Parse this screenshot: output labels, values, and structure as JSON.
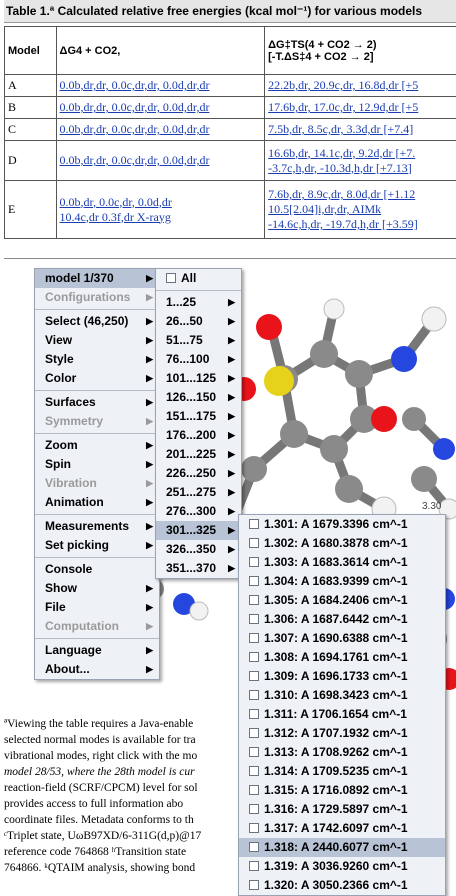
{
  "table": {
    "title": "Table 1.ª Calculated relative free energies (kcal mol⁻¹) for various models",
    "headers": {
      "model": "Model",
      "dg4": "ΔG4 + CO2,",
      "dgts": "ΔG‡TS(4 + CO2 → 2)",
      "tds": "[-T.ΔS‡4 + CO2 → 2]"
    },
    "rows": [
      {
        "model": "A",
        "col1": "0.0b,dr,dr, 0.0c,dr,dr, 0.0d,dr,dr",
        "col2": "22.2b,dr, 20.9c,dr, 16.8d,dr [+5"
      },
      {
        "model": "B",
        "col1": "0.0b,dr,dr, 0.0c,dr,dr, 0.0d,dr,dr",
        "col2": "17.6b,dr, 17.0c,dr, 12.9d,dr [+5"
      },
      {
        "model": "C",
        "col1": "0.0b,dr,dr, 0.0c,dr,dr, 0.0d,dr,dr",
        "col2": "7.5b,dr, 8.5c,dr, 3.3d,dr [+7.4]"
      },
      {
        "model": "D",
        "col1": "0.0b,dr,dr, 0.0c,dr,dr, 0.0d,dr,dr",
        "col2a": "16.6b,dr, 14.1c,dr, 9.2d,dr [+7.",
        "col2b": "-3.7c,h,dr, -10.3d,h,dr [+7.13]"
      },
      {
        "model": "E",
        "col1a": "0.0b,dr, 0.0c,dr, 0.0d,dr",
        "col1b": "10.4c,dr 0.3f,dr X-rayg",
        "col2a": "7.6b,dr, 8.9c,dr, 8.0d,dr [+1.12",
        "col2b": "10.5[2.04]i,dr,dr, AIMk",
        "col2c": "-14.6c,h,dr, -19.7d,h,dr [+3.59]"
      }
    ]
  },
  "menu_main": {
    "items": [
      {
        "label": "model 1/370",
        "arrow": true,
        "selected": true
      },
      {
        "label": "Configurations",
        "arrow": true,
        "disabled": true
      },
      {
        "sep": true
      },
      {
        "label": "Select (46,250)",
        "arrow": true
      },
      {
        "label": "View",
        "arrow": true
      },
      {
        "label": "Style",
        "arrow": true
      },
      {
        "label": "Color",
        "arrow": true
      },
      {
        "sep": true
      },
      {
        "label": "Surfaces",
        "arrow": true
      },
      {
        "label": "Symmetry",
        "arrow": true,
        "disabled": true
      },
      {
        "sep": true
      },
      {
        "label": "Zoom",
        "arrow": true
      },
      {
        "label": "Spin",
        "arrow": true
      },
      {
        "label": "Vibration",
        "arrow": true,
        "disabled": true
      },
      {
        "label": "Animation",
        "arrow": true
      },
      {
        "sep": true
      },
      {
        "label": "Measurements",
        "arrow": true
      },
      {
        "label": "Set picking",
        "arrow": true
      },
      {
        "sep": true
      },
      {
        "label": "Console"
      },
      {
        "label": "Show",
        "arrow": true
      },
      {
        "label": "File",
        "arrow": true
      },
      {
        "label": "Computation",
        "arrow": true,
        "disabled": true
      },
      {
        "sep": true
      },
      {
        "label": "Language",
        "arrow": true
      },
      {
        "label": "About...",
        "arrow": true
      }
    ]
  },
  "menu_models": {
    "items": [
      {
        "label": "All",
        "checkbox": true
      },
      {
        "sep": true
      },
      {
        "label": "1...25",
        "arrow": true
      },
      {
        "label": "26...50",
        "arrow": true
      },
      {
        "label": "51...75",
        "arrow": true
      },
      {
        "label": "76...100",
        "arrow": true
      },
      {
        "label": "101...125",
        "arrow": true
      },
      {
        "label": "126...150",
        "arrow": true
      },
      {
        "label": "151...175",
        "arrow": true
      },
      {
        "label": "176...200",
        "arrow": true
      },
      {
        "label": "201...225",
        "arrow": true
      },
      {
        "label": "226...250",
        "arrow": true
      },
      {
        "label": "251...275",
        "arrow": true
      },
      {
        "label": "276...300",
        "arrow": true
      },
      {
        "label": "301...325",
        "arrow": true,
        "selected": true
      },
      {
        "label": "326...350",
        "arrow": true
      },
      {
        "label": "351...370",
        "arrow": true
      }
    ]
  },
  "menu_modes": {
    "items": [
      {
        "label": "1.301: A 1679.3396 cm^-1"
      },
      {
        "label": "1.302: A 1680.3878 cm^-1"
      },
      {
        "label": "1.303: A 1683.3614 cm^-1"
      },
      {
        "label": "1.304: A 1683.9399 cm^-1"
      },
      {
        "label": "1.305: A 1684.2406 cm^-1"
      },
      {
        "label": "1.306: A 1687.6442 cm^-1"
      },
      {
        "label": "1.307: A 1690.6388 cm^-1"
      },
      {
        "label": "1.308: A 1694.1761 cm^-1"
      },
      {
        "label": "1.309: A 1696.1733 cm^-1"
      },
      {
        "label": "1.310: A 1698.3423 cm^-1"
      },
      {
        "label": "1.311: A 1706.1654 cm^-1"
      },
      {
        "label": "1.312: A 1707.1932 cm^-1"
      },
      {
        "label": "1.313: A 1708.9262 cm^-1"
      },
      {
        "label": "1.314: A 1709.5235 cm^-1"
      },
      {
        "label": "1.315: A 1716.0892 cm^-1"
      },
      {
        "label": "1.316: A 1729.5897 cm^-1"
      },
      {
        "label": "1.317: A 1742.6097 cm^-1"
      },
      {
        "label": "1.318: A 2440.6077 cm^-1",
        "selected": true
      },
      {
        "label": "1.319: A 3036.9260 cm^-1"
      },
      {
        "label": "1.320: A 3050.2366 cm^-1"
      }
    ]
  },
  "footnotes": {
    "line1": "ªViewing the table requires a Java-enable",
    "line2": "selected normal modes is available for tra",
    "line3": "vibrational modes, right click with the mo",
    "line4": "model 28/53, where the 28th model is cur",
    "line5": "reaction-field (SCRF/CPCM) level for sol",
    "line6": "provides access to full information abo",
    "line7": "coordinate files. Metadata conforms to th",
    "line8": "ᶜTriplet state, UωB97XD/6-311G(d,p)@17",
    "line9": "reference code 764868 ʰTransition state",
    "line10": "764866. ᵏQTAIM analysis, showing bond"
  },
  "viewer": {
    "distance_label": "3.30"
  },
  "colors": {
    "link": "#1a3db0",
    "menu_bg": "#eef1f6",
    "menu_selected": "#b8c4d6",
    "carbon": "#8a8a8a",
    "oxygen": "#e8141a",
    "nitrogen": "#2646e0",
    "sulfur": "#e6d21a",
    "hydrogen": "#f2f2f2"
  }
}
